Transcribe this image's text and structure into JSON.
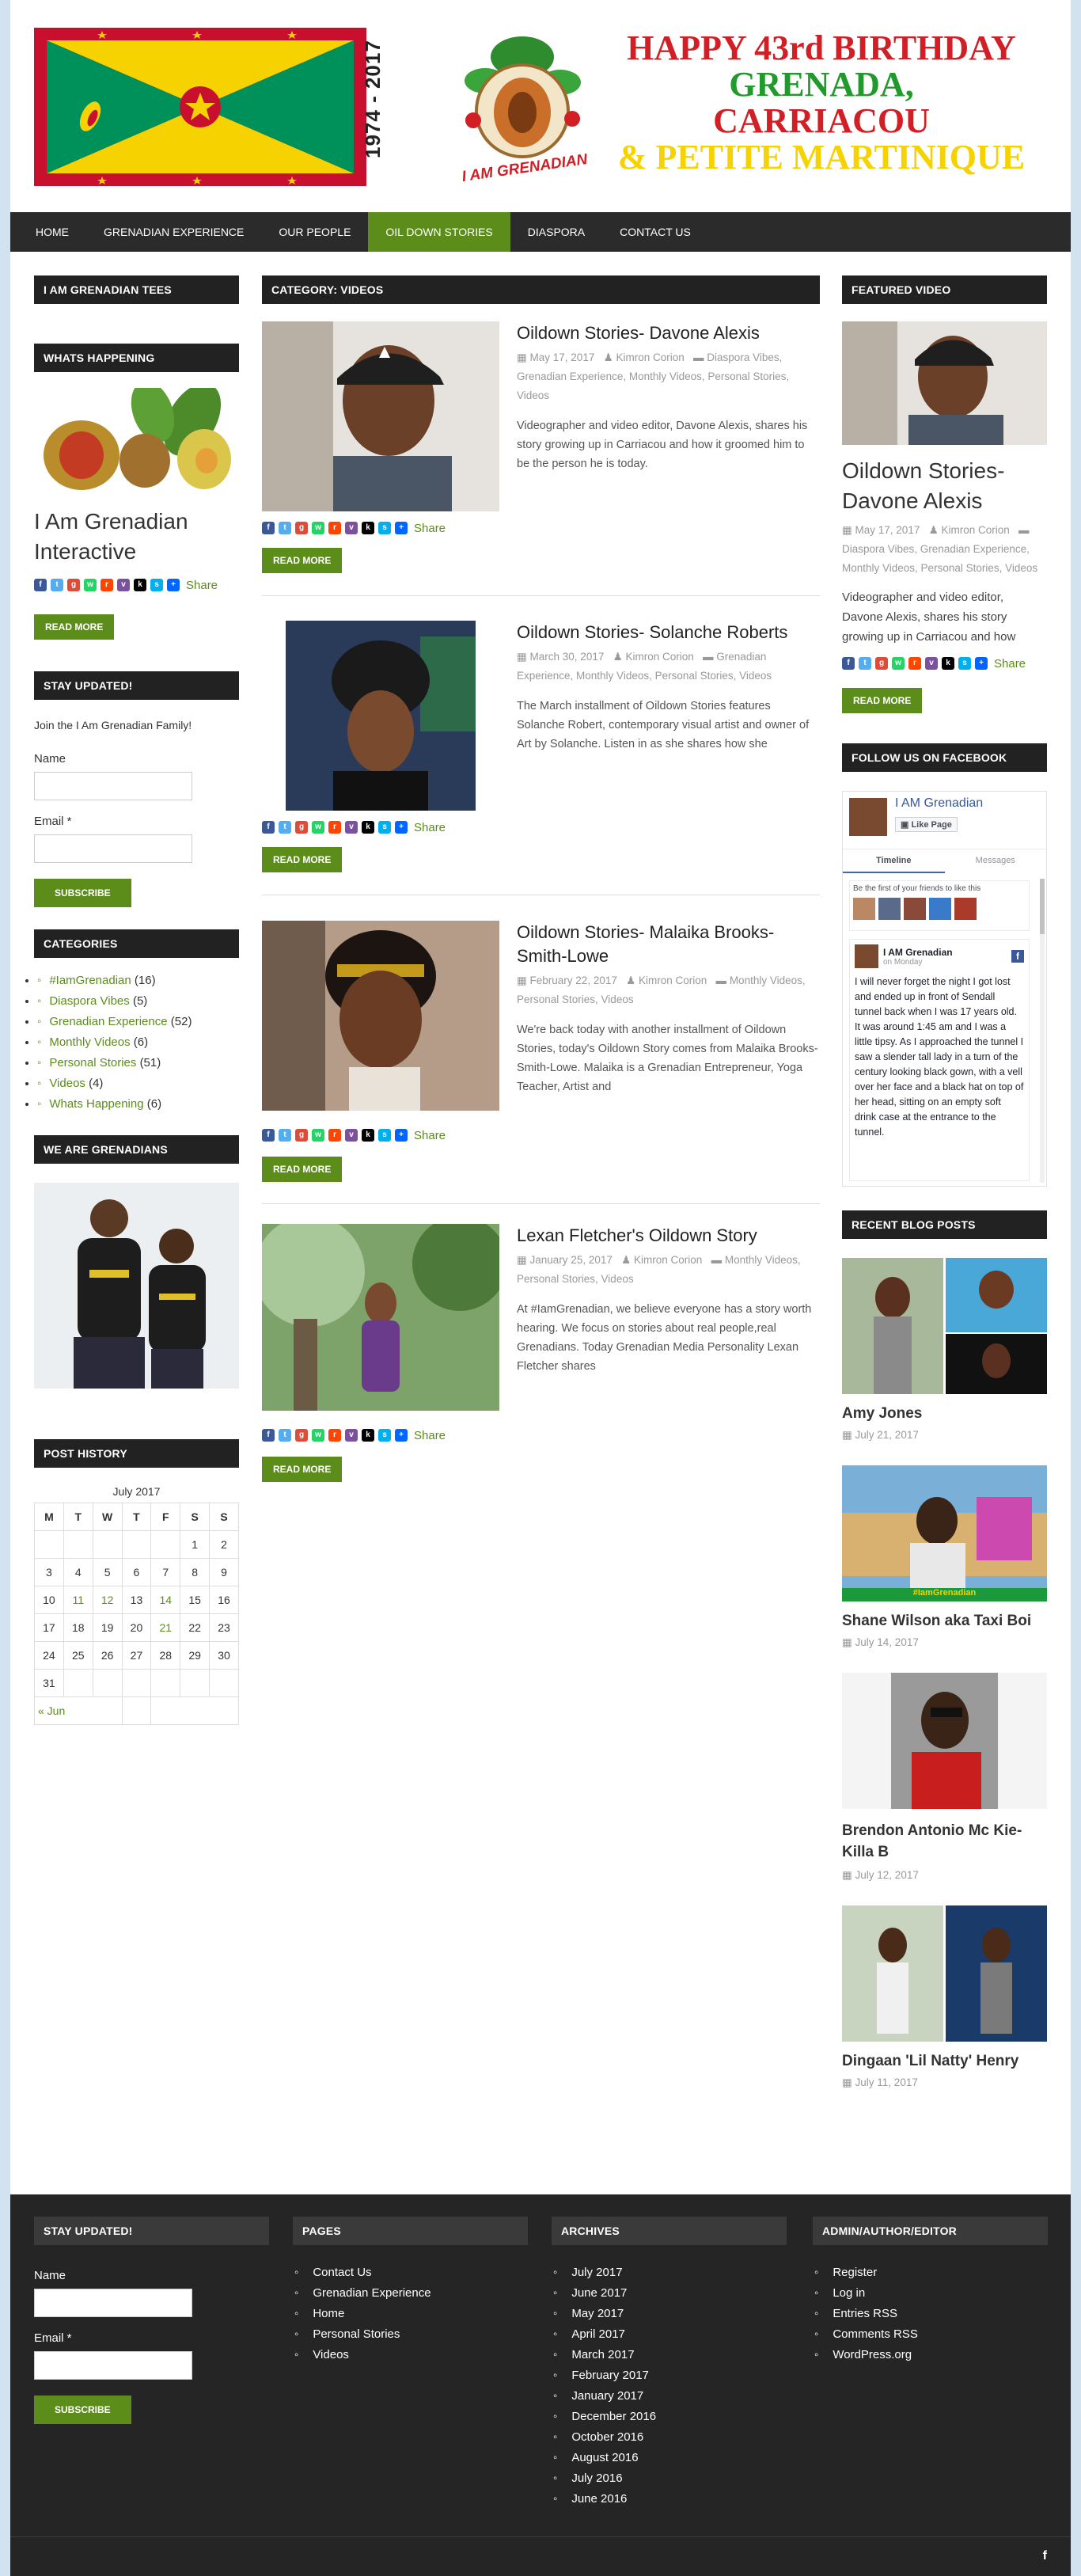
{
  "header": {
    "years": "1974 - 2017",
    "logo_text": "I AM GRENADIAN",
    "birthday_lines": [
      "HAPPY 43rd BIRTHDAY",
      "GRENADA,",
      "CARRIACOU",
      "& PETITE MARTINIQUE"
    ],
    "colors": {
      "red": "#d21f26",
      "green": "#1f9a2b",
      "yellow": "#f6d200",
      "flag_green": "#00915a"
    }
  },
  "nav": {
    "items": [
      {
        "label": "HOME"
      },
      {
        "label": "GRENADIAN EXPERIENCE"
      },
      {
        "label": "OUR PEOPLE"
      },
      {
        "label": "OIL DOWN STORIES"
      },
      {
        "label": "DIASPORA"
      },
      {
        "label": "CONTACT US"
      }
    ],
    "active_index": 3
  },
  "left": {
    "tees_title": "I AM GRENADIAN TEES",
    "happening_title": "WHATS HAPPENING",
    "happening_post_title": "I Am Grenadian Interactive",
    "share_label": "Share",
    "read_more": "READ MORE",
    "stay_title": "STAY UPDATED!",
    "join_text": "Join the I Am Grenadian Family!",
    "name_label": "Name",
    "email_label": "Email *",
    "subscribe": "SUBSCRIBE",
    "categories_title": "CATEGORIES",
    "categories": [
      {
        "name": "#IamGrenadian",
        "count": "(16)"
      },
      {
        "name": "Diaspora Vibes",
        "count": "(5)"
      },
      {
        "name": "Grenadian Experience",
        "count": "(52)"
      },
      {
        "name": "Monthly Videos",
        "count": "(6)"
      },
      {
        "name": "Personal Stories",
        "count": "(51)"
      },
      {
        "name": "Videos",
        "count": "(4)"
      },
      {
        "name": "Whats Happening",
        "count": "(6)"
      }
    ],
    "grenadians_title": "WE ARE GRENADIANS",
    "history_title": "POST HISTORY",
    "calendar": {
      "caption": "July 2017",
      "days": [
        "M",
        "T",
        "W",
        "T",
        "F",
        "S",
        "S"
      ],
      "weeks": [
        [
          "",
          "",
          "",
          "",
          "",
          "1",
          "2"
        ],
        [
          "3",
          "4",
          "5",
          "6",
          "7",
          "8",
          "9"
        ],
        [
          "10",
          "11",
          "12",
          "13",
          "14",
          "15",
          "16"
        ],
        [
          "17",
          "18",
          "19",
          "20",
          "21",
          "22",
          "23"
        ],
        [
          "24",
          "25",
          "26",
          "27",
          "28",
          "29",
          "30"
        ],
        [
          "31",
          "",
          "",
          "",
          "",
          "",
          ""
        ]
      ],
      "linked_days": [
        "11",
        "12",
        "14",
        "21"
      ],
      "prev": "« Jun"
    }
  },
  "main": {
    "category_title": "CATEGORY: VIDEOS",
    "read_more": "READ MORE",
    "share_label": "Share",
    "posts": [
      {
        "title": "Oildown Stories- Davone Alexis",
        "date": "May 17, 2017",
        "author": "Kimron Corion",
        "cats": "Diaspora Vibes, Grenadian Experience, Monthly Videos, Personal Stories, Videos",
        "excerpt": "Videographer and video editor, Davone Alexis, shares his story growing up in Carriacou and how it groomed him to be the person he is today."
      },
      {
        "title": "Oildown Stories- Solanche Roberts",
        "date": "March 30, 2017",
        "author": "Kimron Corion",
        "cats": "Grenadian Experience, Monthly Videos, Personal Stories, Videos",
        "excerpt": "The March installment of Oildown Stories features Solanche Robert, contemporary visual artist and owner of Art by Solanche. Listen in as she shares how she"
      },
      {
        "title": "Oildown Stories- Malaika Brooks-Smith-Lowe",
        "date": "February 22, 2017",
        "author": "Kimron Corion",
        "cats": "Monthly Videos, Personal Stories, Videos",
        "excerpt": "We're back today with another installment of Oildown Stories, today's Oildown Story comes from Malaika Brooks-Smith-Lowe. Malaika is a Grenadian Entrepreneur, Yoga Teacher, Artist and"
      },
      {
        "title": "Lexan Fletcher's Oildown Story",
        "date": "January 25, 2017",
        "author": "Kimron Corion",
        "cats": "Monthly Videos, Personal Stories, Videos",
        "excerpt": "At #IamGrenadian, we believe everyone has a story worth hearing. We focus on stories about real people,real Grenadians. Today Grenadian Media Personality Lexan Fletcher shares"
      }
    ]
  },
  "right": {
    "featured_title": "FEATURED VIDEO",
    "featured_post_title": "Oildown Stories- Davone Alexis",
    "featured_date": "May 17, 2017",
    "featured_author": "Kimron Corion",
    "featured_cats": "Diaspora Vibes, Grenadian Experience, Monthly Videos, Personal Stories, Videos",
    "featured_excerpt": "Videographer and video editor, Davone Alexis, shares his story growing up in Carriacou and how",
    "share_label": "Share",
    "read_more": "READ MORE",
    "fb_title": "FOLLOW US ON FACEBOOK",
    "fb": {
      "page_name": "I AM Grenadian",
      "like_label": "Like Page",
      "tab_timeline": "Timeline",
      "tab_messages": "Messages",
      "friends_text": "Be the first of your friends to like this",
      "post_author": "I AM Grenadian",
      "post_time": "on Monday",
      "post_text": "I will never forget the night I got lost and ended up in front of Sendall tunnel back when I was 17 years old. It was around 1:45 am and I was a little tipsy. As I approached the tunnel I saw a slender tall lady in a turn of the century looking black gown, with a vell over her face and a black hat on top of her head, sitting on an empty soft drink case at the entrance to the tunnel."
    },
    "recent_title": "RECENT BLOG POSTS",
    "recent": [
      {
        "title": "Amy Jones",
        "date": "July 21, 2017"
      },
      {
        "title": "Shane Wilson aka Taxi Boi",
        "date": "July 14, 2017",
        "banner": "#IamGrenadian"
      },
      {
        "title": "Brendon Antonio Mc Kie-Killa B",
        "date": "July 12, 2017"
      },
      {
        "title": "Dingaan 'Lil Natty' Henry",
        "date": "July 11, 2017"
      }
    ]
  },
  "footer": {
    "stay_title": "STAY UPDATED!",
    "name_label": "Name",
    "email_label": "Email *",
    "subscribe": "SUBSCRIBE",
    "pages_title": "PAGES",
    "pages": [
      "Contact Us",
      "Grenadian Experience",
      "Home",
      "Personal Stories",
      "Videos"
    ],
    "archives_title": "ARCHIVES",
    "archives": [
      "July 2017",
      "June 2017",
      "May 2017",
      "April 2017",
      "March 2017",
      "February 2017",
      "January 2017",
      "December 2016",
      "October 2016",
      "August 2016",
      "July 2016",
      "June 2016"
    ],
    "admin_title": "ADMIN/AUTHOR/EDITOR",
    "admin_links": [
      "Register",
      "Log in",
      "Entries RSS",
      "Comments RSS",
      "WordPress.org"
    ],
    "social_icon": "f"
  }
}
